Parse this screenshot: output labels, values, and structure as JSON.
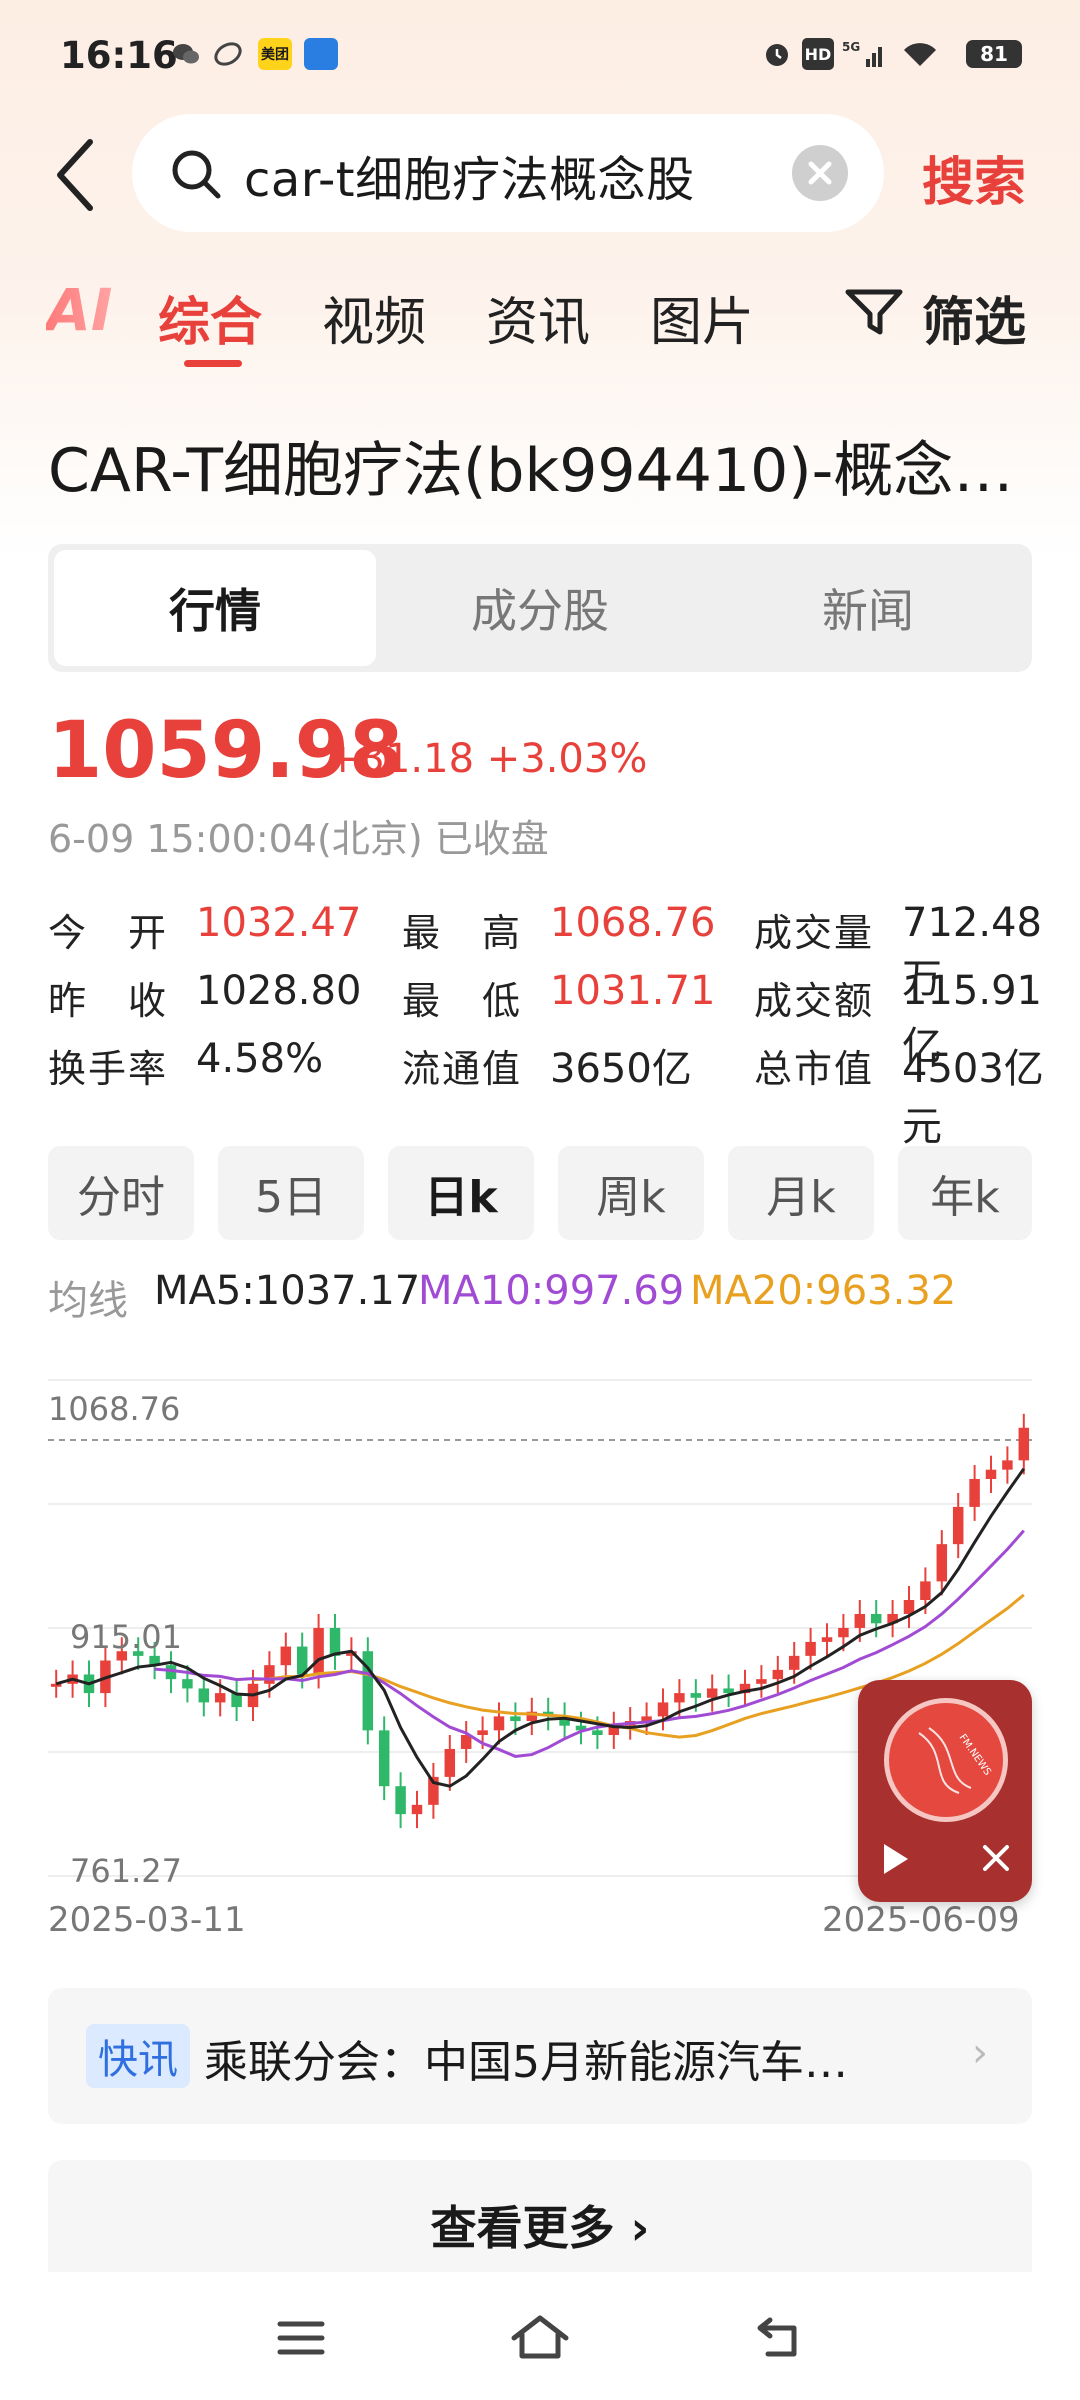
{
  "status": {
    "time": "16:16",
    "battery": "81",
    "app_icon_1": "美团",
    "network": "5G"
  },
  "search": {
    "query": "car-t细胞疗法概念股",
    "button": "搜索"
  },
  "tabs": [
    "综合",
    "视频",
    "资讯",
    "图片"
  ],
  "filter_label": "筛选",
  "ai_label": "AI",
  "title": "CAR-T细胞疗法(bk994410)-概念…",
  "segments": [
    "行情",
    "成分股",
    "新闻"
  ],
  "quote": {
    "price": "1059.98",
    "change": "+31.18 +3.03%",
    "timestamp": "6-09 15:00:04(北京) 已收盘"
  },
  "stats": [
    {
      "label": "今　开",
      "value": "1032.47",
      "color": "red"
    },
    {
      "label": "最　高",
      "value": "1068.76",
      "color": "red"
    },
    {
      "label": "成交量",
      "value": "712.48万",
      "color": "black"
    },
    {
      "label": "昨　收",
      "value": "1028.80",
      "color": "black"
    },
    {
      "label": "最　低",
      "value": "1031.71",
      "color": "red"
    },
    {
      "label": "成交额",
      "value": "115.91亿",
      "color": "black"
    },
    {
      "label": "换手率",
      "value": "4.58%",
      "color": "black"
    },
    {
      "label": "流通值",
      "value": "3650亿",
      "color": "black"
    },
    {
      "label": "总市值",
      "value": "4503亿元",
      "color": "black"
    }
  ],
  "periods": [
    "分时",
    "5日",
    "日k",
    "周k",
    "月k",
    "年k"
  ],
  "ma": {
    "label": "均线",
    "ma5": "MA5:1037.17",
    "ma10": "MA10:997.69",
    "ma20": "MA20:963.32",
    "colors": {
      "ma5": "#222222",
      "ma10": "#a14bd4",
      "ma20": "#e8a020"
    }
  },
  "chart_data": {
    "type": "candlestick",
    "y_ticks": [
      "1068.76",
      "915.01",
      "761.27"
    ],
    "x_labels": [
      "2025-03-11",
      "2025-06-09"
    ],
    "ylim": [
      761.27,
      1068.76
    ],
    "up_color": "#e8413b",
    "down_color": "#2fb86a"
  },
  "news": {
    "badge": "快讯",
    "text": "乘联分会：中国5月新能源汽车…"
  },
  "more": "查看更多 ›",
  "fm": {
    "label": "FM.NEWS"
  }
}
